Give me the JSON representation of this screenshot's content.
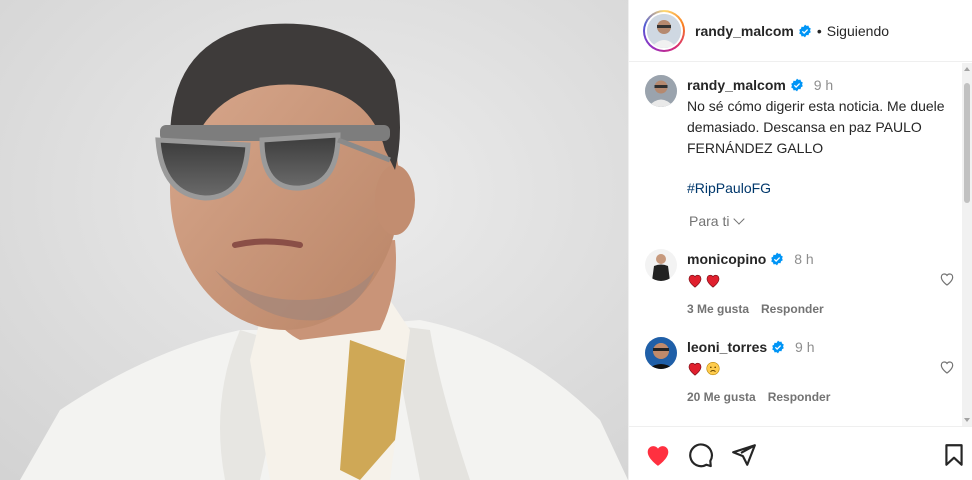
{
  "post_author": {
    "username": "randy_malcom",
    "separator": "•",
    "follow_status": "Siguiendo"
  },
  "caption": {
    "username": "randy_malcom",
    "time": "9 h",
    "text": "No sé cómo digerir esta noticia. Me duele demasiado. Descansa en paz PAULO FERNÁNDEZ GALLO",
    "hashtag": "#RipPauloFG",
    "translate_label": "Para ti"
  },
  "comments": [
    {
      "username": "monicopino",
      "time": "8 h",
      "likes": "3 Me gusta",
      "reply": "Responder"
    },
    {
      "username": "leoni_torres",
      "time": "9 h",
      "likes": "20 Me gusta",
      "reply": "Responder"
    }
  ],
  "colors": {
    "like_red": "#ff3040",
    "link_blue": "#00376b",
    "verified_blue": "#0095f6"
  },
  "icons": [
    "heart-icon",
    "comment-icon",
    "share-icon",
    "bookmark-icon",
    "verified-icon",
    "chevron-down-icon"
  ]
}
